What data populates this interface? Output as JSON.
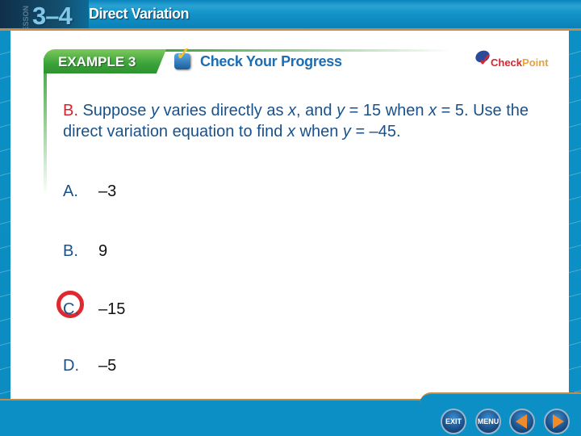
{
  "header": {
    "lesson_label": "LESSON",
    "lesson_number": "3–4",
    "lesson_title": "Direct Variation"
  },
  "example": {
    "tab_label": "EXAMPLE 3",
    "banner_label": "Check Your Progress",
    "check_icon": "checkbox-check-icon"
  },
  "logo": {
    "part1": "Check",
    "part2": "Point"
  },
  "question": {
    "lead": "B.",
    "segments": [
      {
        "text": " Suppose ",
        "italic": false
      },
      {
        "text": "y",
        "italic": true
      },
      {
        "text": " varies directly as ",
        "italic": false
      },
      {
        "text": "x",
        "italic": true
      },
      {
        "text": ", and ",
        "italic": false
      },
      {
        "text": "y",
        "italic": true
      },
      {
        "text": " = 15 when ",
        "italic": false
      },
      {
        "text": "x",
        "italic": true
      },
      {
        "text": " = 5. Use the direct variation equation to find ",
        "italic": false
      },
      {
        "text": "x",
        "italic": true
      },
      {
        "text": " when ",
        "italic": false
      },
      {
        "text": "y",
        "italic": true
      },
      {
        "text": " = –45.",
        "italic": false
      }
    ]
  },
  "answers": [
    {
      "letter": "A.",
      "value": "–3",
      "selected": false
    },
    {
      "letter": "B.",
      "value": "9",
      "selected": false
    },
    {
      "letter": "C.",
      "value": "–15",
      "selected": true
    },
    {
      "letter": "D.",
      "value": "–5",
      "selected": false
    }
  ],
  "nav": {
    "exit_label": "EXIT",
    "menu_label": "MENU",
    "prev_icon": "previous-arrow-icon",
    "next_icon": "next-arrow-icon"
  },
  "colors": {
    "background_blue": "#0b8fc4",
    "accent_orange": "#c98a45",
    "question_blue": "#1a5189",
    "lead_red": "#d0252e",
    "example_green": "#3aa33a",
    "selection_circle": "#e0282f"
  }
}
